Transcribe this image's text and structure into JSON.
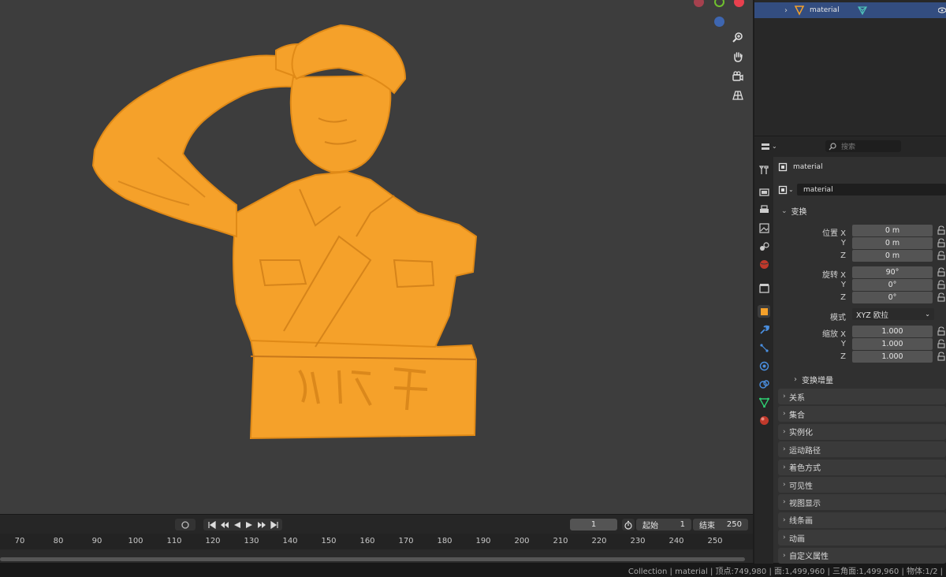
{
  "outliner": {
    "item_label": "material"
  },
  "timeline": {
    "current_frame": "1",
    "start_label": "起始",
    "start_value": "1",
    "end_label": "结束",
    "end_value": "250",
    "ticks": [
      "70",
      "80",
      "90",
      "100",
      "110",
      "120",
      "130",
      "140",
      "150",
      "160",
      "170",
      "180",
      "190",
      "200",
      "210",
      "220",
      "230",
      "240",
      "250"
    ]
  },
  "properties": {
    "search_placeholder": "搜索",
    "object_name": "material",
    "datablock_name": "material",
    "transform_header": "变换",
    "location_label": "位置 X",
    "location_x": "0 m",
    "location_y": "0 m",
    "location_z": "0 m",
    "rotation_label": "旋转 X",
    "rotation_x": "90°",
    "rotation_y": "0°",
    "rotation_z": "0°",
    "mode_label": "模式",
    "mode_value": "XYZ 欧拉",
    "scale_label": "缩放 X",
    "scale_x": "1.000",
    "scale_y": "1.000",
    "scale_z": "1.000",
    "y_label": "Y",
    "z_label": "Z",
    "delta_transform": "变换增量",
    "panels": [
      "关系",
      "集合",
      "实例化",
      "运动路径",
      "着色方式",
      "可见性",
      "视图显示",
      "线条画",
      "动画",
      "自定义属性"
    ]
  },
  "statusbar": {
    "text": "Collection | material | 顶点:749,980 | 面:1,499,960 | 三角面:1,499,960 | 物体:1/2 |"
  },
  "colors": {
    "selection_orange": "#f5a12a",
    "outliner_highlight": "#334d80",
    "viewport_bg": "#3d3d3d"
  }
}
